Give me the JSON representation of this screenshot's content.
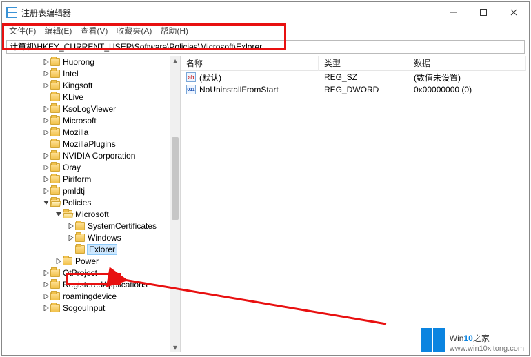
{
  "window": {
    "title": "注册表编辑器"
  },
  "menu": {
    "file": "文件(F)",
    "edit": "编辑(E)",
    "view": "查看(V)",
    "favorites": "收藏夹(A)",
    "help": "帮助(H)"
  },
  "address": {
    "path": "计算机\\HKEY_CURRENT_USER\\Software\\Policies\\Microsoft\\Exlorer"
  },
  "tree": {
    "items": [
      {
        "depth": 3,
        "expander": ">",
        "label": "Huorong"
      },
      {
        "depth": 3,
        "expander": ">",
        "label": "Intel"
      },
      {
        "depth": 3,
        "expander": ">",
        "label": "Kingsoft"
      },
      {
        "depth": 3,
        "expander": "",
        "label": "KLive"
      },
      {
        "depth": 3,
        "expander": ">",
        "label": "KsoLogViewer"
      },
      {
        "depth": 3,
        "expander": ">",
        "label": "Microsoft"
      },
      {
        "depth": 3,
        "expander": ">",
        "label": "Mozilla"
      },
      {
        "depth": 3,
        "expander": "",
        "label": "MozillaPlugins"
      },
      {
        "depth": 3,
        "expander": ">",
        "label": "NVIDIA Corporation"
      },
      {
        "depth": 3,
        "expander": ">",
        "label": "Oray"
      },
      {
        "depth": 3,
        "expander": ">",
        "label": "Piriform"
      },
      {
        "depth": 3,
        "expander": ">",
        "label": "pmldtj"
      },
      {
        "depth": 3,
        "expander": "v",
        "label": "Policies",
        "open": true
      },
      {
        "depth": 4,
        "expander": "v",
        "label": "Microsoft",
        "open": true
      },
      {
        "depth": 5,
        "expander": ">",
        "label": "SystemCertificates"
      },
      {
        "depth": 5,
        "expander": ">",
        "label": "Windows"
      },
      {
        "depth": 5,
        "expander": "",
        "label": "Exlorer",
        "selected": true
      },
      {
        "depth": 4,
        "expander": ">",
        "label": "Power"
      },
      {
        "depth": 3,
        "expander": ">",
        "label": "QtProject"
      },
      {
        "depth": 3,
        "expander": ">",
        "label": "RegisteredApplications"
      },
      {
        "depth": 3,
        "expander": ">",
        "label": "roamingdevice"
      },
      {
        "depth": 3,
        "expander": ">",
        "label": "SogouInput"
      }
    ]
  },
  "columns": {
    "name": "名称",
    "type": "类型",
    "data": "数据"
  },
  "rows": [
    {
      "icon": "ab",
      "name": "(默认)",
      "type": "REG_SZ",
      "data": "(数值未设置)"
    },
    {
      "icon": "dw",
      "name": "NoUninstallFromStart",
      "type": "REG_DWORD",
      "data": "0x00000000 (0)"
    }
  ],
  "watermark": {
    "brand_pre": "Win",
    "brand_accent": "10",
    "brand_post": "之家",
    "url": "www.win10xitong.com"
  }
}
